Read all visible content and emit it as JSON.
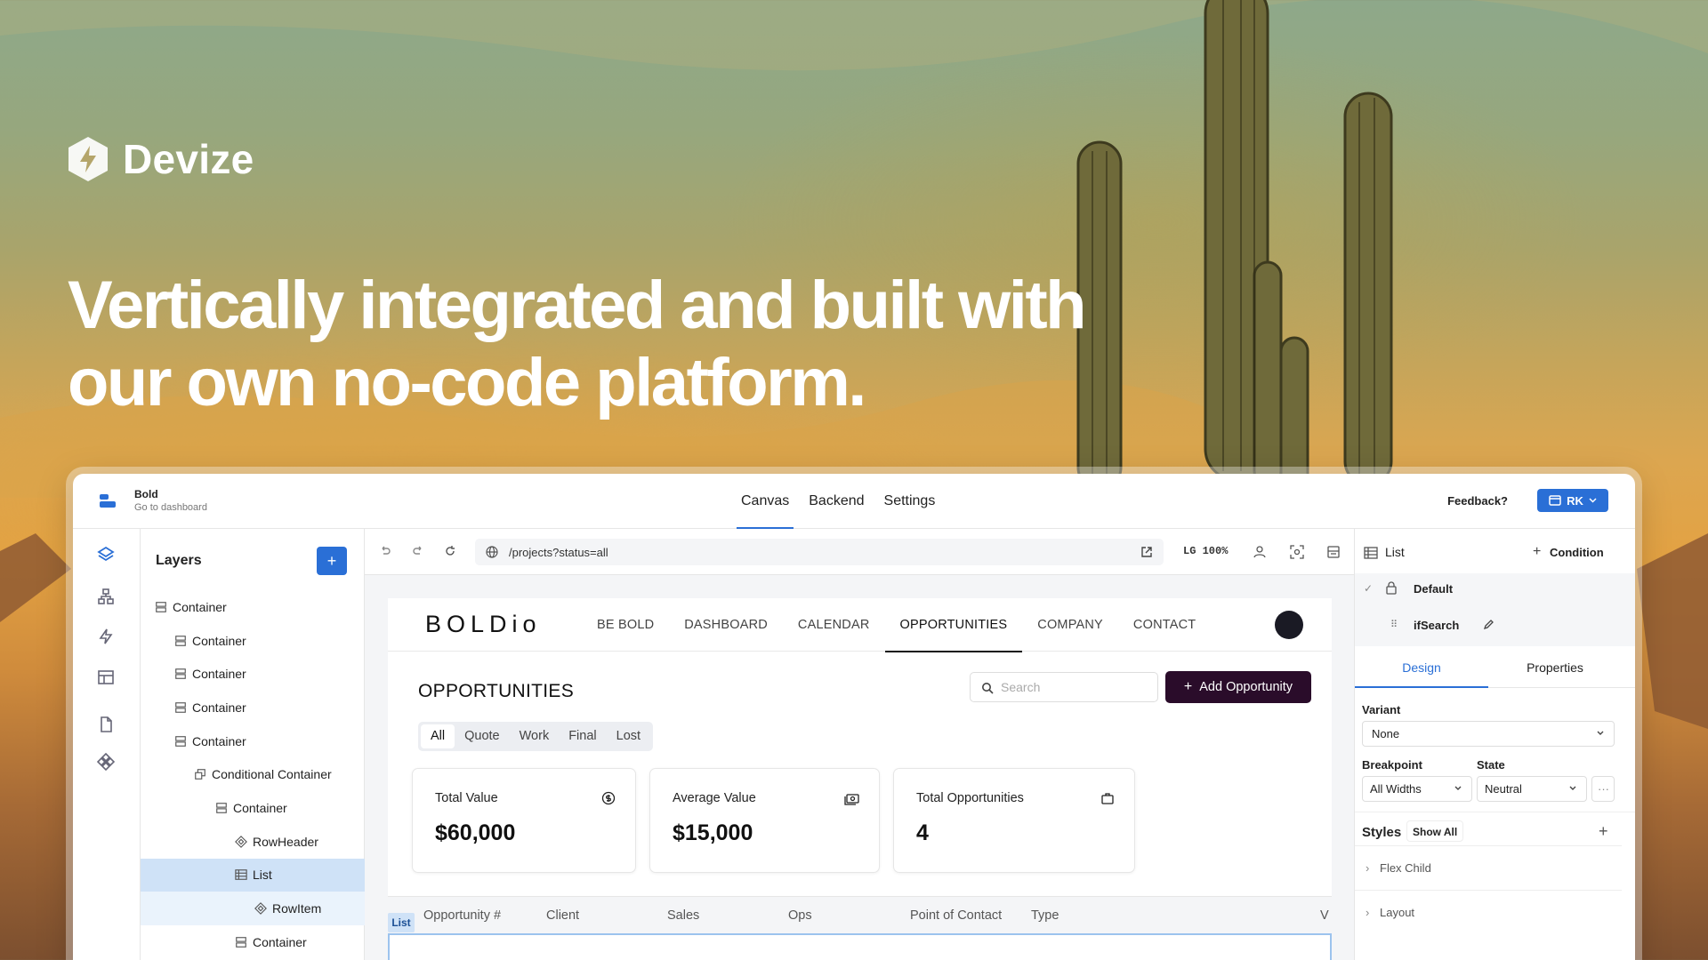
{
  "brand": {
    "name": "Devize"
  },
  "headline": {
    "line1": "Vertically integrated and built with",
    "line2": "our own no-code platform."
  },
  "app": {
    "project": {
      "name": "Bold",
      "subtitle": "Go to dashboard"
    },
    "tabs": [
      {
        "label": "Canvas",
        "active": true
      },
      {
        "label": "Backend"
      },
      {
        "label": "Settings"
      }
    ],
    "feedback_label": "Feedback?",
    "user_initials": "RK",
    "rail_icons": [
      "layers-icon",
      "hierarchy-icon",
      "lightning-icon",
      "data-table-icon",
      "page-icon",
      "component-icon"
    ],
    "layers": {
      "title": "Layers",
      "add_label": "+",
      "items": [
        {
          "label": "Container",
          "icon": "container-icon",
          "depth": 0
        },
        {
          "label": "Container",
          "icon": "container-icon",
          "depth": 1
        },
        {
          "label": "Container",
          "icon": "container-icon",
          "depth": 1
        },
        {
          "label": "Container",
          "icon": "container-icon",
          "depth": 1
        },
        {
          "label": "Container",
          "icon": "container-icon",
          "depth": 1
        },
        {
          "label": "Conditional Container",
          "icon": "conditional-icon",
          "depth": 2
        },
        {
          "label": "Container",
          "icon": "container-icon",
          "depth": 3
        },
        {
          "label": "RowHeader",
          "icon": "component-icon",
          "depth": 4
        },
        {
          "label": "List",
          "icon": "list-icon",
          "depth": 4,
          "selected": true
        },
        {
          "label": "RowItem",
          "icon": "component-icon",
          "depth": 5
        },
        {
          "label": "Container",
          "icon": "container-icon",
          "depth": 4
        }
      ]
    },
    "toolbar": {
      "url": "/projects?status=all",
      "zoom": "LG 100%"
    },
    "preview": {
      "logo": "BOLDio",
      "nav": [
        {
          "label": "BE BOLD"
        },
        {
          "label": "DASHBOARD"
        },
        {
          "label": "CALENDAR"
        },
        {
          "label": "OPPORTUNITIES",
          "active": true
        },
        {
          "label": "COMPANY"
        },
        {
          "label": "CONTACT"
        }
      ],
      "title": "OPPORTUNITIES",
      "search_placeholder": "Search",
      "add_button": "Add Opportunity",
      "filters": [
        {
          "label": "All",
          "active": true
        },
        {
          "label": "Quote"
        },
        {
          "label": "Work"
        },
        {
          "label": "Final"
        },
        {
          "label": "Lost"
        }
      ],
      "cards": [
        {
          "label": "Total Value",
          "value": "$60,000",
          "icon": "dollar-icon"
        },
        {
          "label": "Average Value",
          "value": "$15,000",
          "icon": "cash-icon"
        },
        {
          "label": "Total Opportunities",
          "value": "4",
          "icon": "briefcase-icon"
        }
      ],
      "table_columns": [
        "Opportunity #",
        "Client",
        "Sales",
        "Ops",
        "Point of Contact",
        "Type",
        "V"
      ],
      "list_tag": "List"
    },
    "properties": {
      "element": "List",
      "condition_label": "Condition",
      "states": [
        {
          "label": "Default"
        },
        {
          "label": "ifSearch"
        }
      ],
      "tabs": [
        {
          "label": "Design",
          "active": true
        },
        {
          "label": "Properties"
        }
      ],
      "variant": {
        "label": "Variant",
        "value": "None"
      },
      "breakpoint": {
        "label": "Breakpoint",
        "value": "All Widths"
      },
      "state": {
        "label": "State",
        "value": "Neutral"
      },
      "more_label": "···",
      "styles": {
        "title": "Styles",
        "show_all": "Show All",
        "add_label": "+"
      },
      "sections": [
        {
          "label": "Flex Child"
        },
        {
          "label": "Layout"
        }
      ]
    }
  },
  "colors": {
    "accent": "#2a6fd6",
    "selection": "#cfe2f7",
    "add_button": "#2a0c2a"
  }
}
